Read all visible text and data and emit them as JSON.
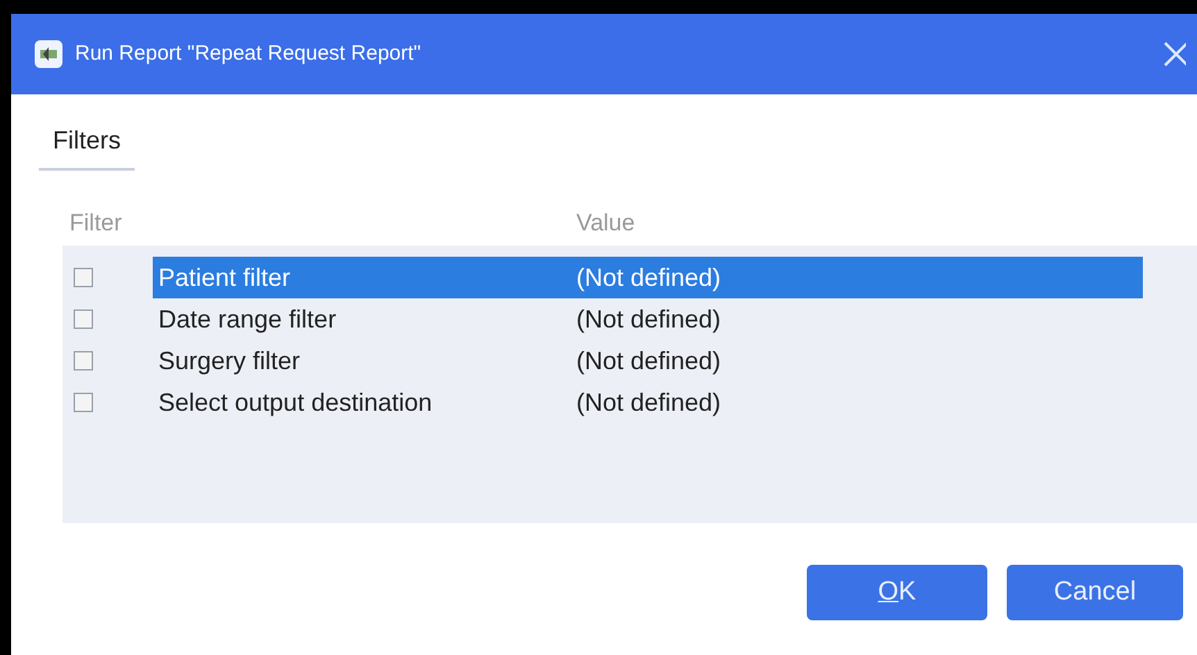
{
  "window": {
    "title": "Run Report \"Repeat Request Report\""
  },
  "tabs": [
    {
      "label": "Filters",
      "selected": true
    }
  ],
  "table": {
    "columns": [
      "Filter",
      "Value"
    ],
    "rows": [
      {
        "filter": "Patient filter",
        "value": "(Not defined)",
        "checked": false,
        "selected": true
      },
      {
        "filter": "Date range filter",
        "value": "(Not defined)",
        "checked": false,
        "selected": false
      },
      {
        "filter": "Surgery filter",
        "value": "(Not defined)",
        "checked": false,
        "selected": false
      },
      {
        "filter": "Select output destination",
        "value": "(Not defined)",
        "checked": false,
        "selected": false
      }
    ]
  },
  "buttons": [
    {
      "label": "OK",
      "mnemonic": true
    },
    {
      "label": "Cancel",
      "mnemonic": false
    }
  ]
}
